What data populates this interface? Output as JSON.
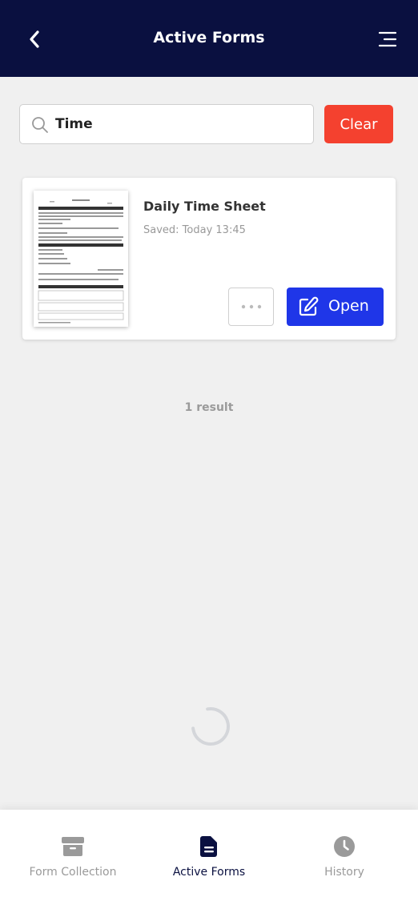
{
  "header": {
    "title": "Active Forms",
    "back_icon": "chevron-left-icon",
    "menu_icon": "menu-icon",
    "background": "#0a1040"
  },
  "search": {
    "value": "Time",
    "icon": "search-icon",
    "clear_label": "Clear",
    "clear_color": "#f4412f"
  },
  "results": [
    {
      "title": "Daily Time Sheet",
      "saved": "Saved: Today 13:45",
      "open_label": "Open",
      "open_color": "#1f36e8"
    }
  ],
  "result_count": "1 result",
  "bottom_nav": {
    "items": [
      {
        "label": "Form Collection",
        "icon": "archive-box-icon",
        "active": false
      },
      {
        "label": "Active Forms",
        "icon": "document-icon",
        "active": true
      },
      {
        "label": "History",
        "icon": "clock-icon",
        "active": false
      }
    ]
  }
}
